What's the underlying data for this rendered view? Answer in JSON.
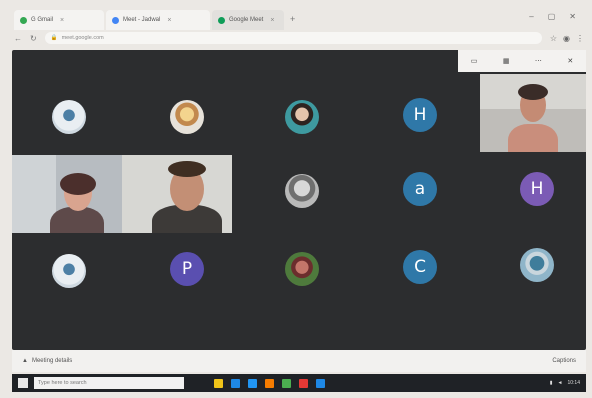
{
  "browser": {
    "tabs": [
      {
        "title": "G Gmail",
        "color": "#34a853"
      },
      {
        "title": "Meet - Jadwal",
        "color": "#4285f4"
      },
      {
        "title": "Google Meet",
        "color": "#0f9d58"
      }
    ],
    "new_tab": "+",
    "address": "meet.google.com",
    "window_controls": {
      "minimize": "–",
      "maximize": "▢",
      "close": "✕"
    }
  },
  "meet": {
    "toolbar": [
      "▭",
      "▦",
      "⋯",
      "✕"
    ],
    "participants": [
      {
        "type": "photo",
        "variant": "p7"
      },
      {
        "type": "photo",
        "variant": "p2"
      },
      {
        "type": "photo",
        "variant": "p3"
      },
      {
        "type": "letter",
        "letter": "H",
        "color": "#2f78a8"
      },
      {
        "type": "photo",
        "variant": "p4"
      },
      {
        "type": "letter",
        "letter": "a",
        "color": "#2f78a8"
      },
      {
        "type": "letter",
        "letter": "H",
        "color": "#7b5bb5"
      },
      {
        "type": "photo",
        "variant": "p8"
      },
      {
        "type": "letter",
        "letter": "P",
        "color": "#5a4fb0"
      },
      {
        "type": "photo",
        "variant": "p5"
      },
      {
        "type": "letter",
        "letter": "C",
        "color": "#2f78a8"
      },
      {
        "type": "photo",
        "variant": "p6"
      }
    ],
    "bar": {
      "meeting_label": "Meeting details",
      "right_label": "Captions"
    }
  },
  "taskbar": {
    "search_placeholder": "Type here to search",
    "icon_colors": [
      "#f0c419",
      "#1e88e5",
      "#2196f3",
      "#f57c00",
      "#4caf50",
      "#e53935",
      "#1e88e5"
    ],
    "time": "10:14"
  }
}
